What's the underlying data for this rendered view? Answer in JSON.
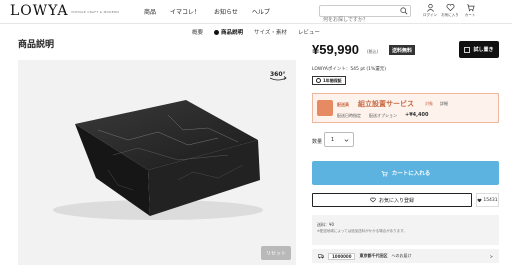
{
  "header": {
    "logo": "LOWYA",
    "logo_sub": "VINTAGE CRAFT & MODERN",
    "nav": [
      "商品",
      "イマコレ！",
      "お知らせ",
      "ヘルプ"
    ],
    "search_placeholder": "何をお探しですか？",
    "icons": [
      {
        "name": "login-icon",
        "label": "ログイン"
      },
      {
        "name": "heart-icon",
        "label": "お気に入り"
      },
      {
        "name": "cart-icon",
        "label": "カート"
      }
    ]
  },
  "tabs": [
    "概要",
    "商品説明",
    "サイズ・素材",
    "レビュー"
  ],
  "active_tab": "商品説明",
  "left": {
    "section_title": "商品説明",
    "icon_360_label": "360°",
    "reset_label": "リセット"
  },
  "product": {
    "price": "¥59,990",
    "tax_label": "(税込)",
    "shipping_badge": "送料無料",
    "sample_button": "試し置き",
    "points": "LOWYAポイント：545 pt (1%還元)",
    "warranty": "1年間保証"
  },
  "assembly": {
    "label": "配送員",
    "title": "組立設置サービス",
    "target": "対象",
    "target_sub": "詳細",
    "date_label": "配送日時指定",
    "option_label": "配送オプション",
    "price": "+¥4,400"
  },
  "purchase": {
    "qty_label": "数量",
    "qty_value": "1",
    "cart_button": "カートに入れる",
    "fav_button": "お気に入り登録",
    "fav_count": "15431"
  },
  "info": {
    "line1": "送料：¥0",
    "line2": "※配送地域によっては追加送料がかかる場合があります。"
  },
  "delivery": {
    "zip": "1000000",
    "address": "東京都千代田区",
    "suffix": "へのお届け",
    "arrow": ">"
  },
  "colors": {
    "cart_button": "#5cb3e0",
    "assembly_accent": "#e58a62",
    "assembly_bg": "#fdf2ec"
  }
}
